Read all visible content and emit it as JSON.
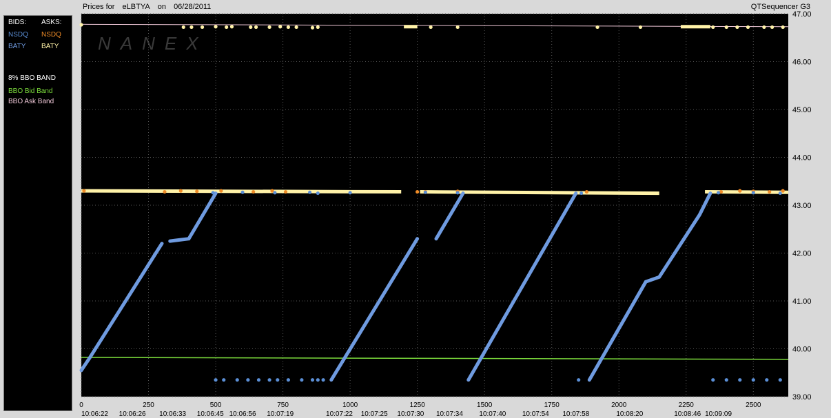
{
  "window": {
    "prices_for": "Prices for",
    "symbol": "eLBTYA",
    "on": "on",
    "date": "06/28/2011",
    "app": "QTSequencer G3",
    "watermark": "NANEX"
  },
  "legend": {
    "bids_label": "BIDS:",
    "asks_label": "ASKS:",
    "bid_nsdq": "NSDQ",
    "ask_nsdq": "NSDQ",
    "bid_baty": "BATY",
    "ask_baty": "BATY",
    "band_title": "8% BBO BAND",
    "bid_band": "BBO Bid Band",
    "ask_band": "BBO Ask Band",
    "colors": {
      "nsdq_bid": "#5b8fd6",
      "nsdq_ask": "#f08c28",
      "baty_bid": "#6f9be0",
      "baty_ask": "#fff2a8",
      "bid_band": "#7cdc3c",
      "ask_band": "#f0c8d8"
    }
  },
  "chart_data": {
    "type": "scatter",
    "ylim": [
      39.0,
      47.0
    ],
    "xlim": [
      0,
      2630
    ],
    "y_ticks": [
      "39.00",
      "40.00",
      "41.00",
      "42.00",
      "43.00",
      "44.00",
      "45.00",
      "46.00",
      "47.00"
    ],
    "x_ticks": [
      "0",
      "250",
      "500",
      "750",
      "1000",
      "1250",
      "1500",
      "1750",
      "2000",
      "2250",
      "2500"
    ],
    "x_times": [
      {
        "x": 50,
        "t": "10:06:22"
      },
      {
        "x": 190,
        "t": "10:06:26"
      },
      {
        "x": 340,
        "t": "10:06:33"
      },
      {
        "x": 480,
        "t": "10:06:45"
      },
      {
        "x": 600,
        "t": "10:06:56"
      },
      {
        "x": 740,
        "t": "10:07:19"
      },
      {
        "x": 960,
        "t": "10:07:22"
      },
      {
        "x": 1090,
        "t": "10:07:25"
      },
      {
        "x": 1225,
        "t": "10:07:30"
      },
      {
        "x": 1370,
        "t": "10:07:34"
      },
      {
        "x": 1530,
        "t": "10:07:40"
      },
      {
        "x": 1690,
        "t": "10:07:54"
      },
      {
        "x": 1840,
        "t": "10:07:58"
      },
      {
        "x": 2040,
        "t": "10:08:20"
      },
      {
        "x": 2255,
        "t": "10:08:46"
      },
      {
        "x": 2370,
        "t": "10:09:09"
      }
    ],
    "series": [
      {
        "name": "BATY",
        "segments": [
          [
            [
              0,
              39.55
            ],
            [
              30,
              39.8
            ],
            [
              300,
              42.2
            ]
          ],
          [
            [
              330,
              42.25
            ],
            [
              400,
              42.3
            ],
            [
              500,
              43.25
            ]
          ],
          [
            [
              930,
              39.35
            ],
            [
              1250,
              42.3
            ]
          ],
          [
            [
              1320,
              42.3
            ],
            [
              1420,
              43.25
            ]
          ],
          [
            [
              1440,
              39.35
            ],
            [
              1840,
              43.25
            ]
          ],
          [
            [
              1890,
              39.35
            ],
            [
              2100,
              41.4
            ],
            [
              2150,
              41.5
            ],
            [
              2300,
              42.8
            ],
            [
              2340,
              43.25
            ]
          ]
        ]
      },
      {
        "name": "NSDQ",
        "points": [
          [
            490,
            43.26
          ],
          [
            600,
            43.27
          ],
          [
            720,
            43.26
          ],
          [
            850,
            43.27
          ],
          [
            880,
            43.25
          ],
          [
            1000,
            43.26
          ],
          [
            1280,
            43.27
          ],
          [
            1400,
            43.26
          ],
          [
            1860,
            43.25
          ],
          [
            2370,
            43.26
          ],
          [
            2500,
            43.26
          ],
          [
            2600,
            43.25
          ]
        ],
        "low_points": [
          [
            500,
            39.35
          ],
          [
            530,
            39.35
          ],
          [
            580,
            39.35
          ],
          [
            620,
            39.35
          ],
          [
            660,
            39.35
          ],
          [
            700,
            39.35
          ],
          [
            730,
            39.35
          ],
          [
            770,
            39.35
          ],
          [
            820,
            39.35
          ],
          [
            860,
            39.35
          ],
          [
            880,
            39.35
          ],
          [
            900,
            39.35
          ],
          [
            1850,
            39.35
          ],
          [
            2350,
            39.35
          ],
          [
            2400,
            39.35
          ],
          [
            2450,
            39.35
          ],
          [
            2500,
            39.35
          ],
          [
            2550,
            39.35
          ],
          [
            2600,
            39.35
          ]
        ]
      },
      {
        "name": "NSDQ",
        "points": [
          [
            10,
            43.3
          ],
          [
            310,
            43.28
          ],
          [
            370,
            43.3
          ],
          [
            430,
            43.29
          ],
          [
            520,
            43.3
          ],
          [
            640,
            43.28
          ],
          [
            710,
            43.3
          ],
          [
            760,
            43.28
          ],
          [
            1250,
            43.28
          ],
          [
            1280,
            43.28
          ],
          [
            1400,
            43.29
          ],
          [
            1880,
            43.28
          ],
          [
            2380,
            43.28
          ],
          [
            2450,
            43.3
          ],
          [
            2500,
            43.29
          ],
          [
            2560,
            43.28
          ],
          [
            2610,
            43.3
          ]
        ]
      },
      {
        "name": "BATY",
        "main": [
          [
            0,
            43.3
          ],
          [
            1190,
            43.28
          ]
        ],
        "main2": [
          [
            1260,
            43.28
          ],
          [
            2150,
            43.25
          ]
        ],
        "main3": [
          [
            2320,
            43.28
          ],
          [
            2630,
            43.27
          ]
        ],
        "upper": [
          [
            0,
            46.77
          ],
          [
            380,
            46.72
          ],
          [
            410,
            46.72
          ],
          [
            450,
            46.72
          ],
          [
            500,
            46.73
          ],
          [
            540,
            46.72
          ],
          [
            560,
            46.73
          ],
          [
            630,
            46.72
          ],
          [
            650,
            46.72
          ],
          [
            700,
            46.72
          ],
          [
            740,
            46.73
          ],
          [
            770,
            46.72
          ],
          [
            800,
            46.72
          ],
          [
            860,
            46.71
          ],
          [
            880,
            46.72
          ],
          [
            1300,
            46.72
          ],
          [
            1400,
            46.72
          ],
          [
            1920,
            46.72
          ],
          [
            2080,
            46.72
          ],
          [
            2350,
            46.72
          ],
          [
            2400,
            46.72
          ],
          [
            2440,
            46.72
          ],
          [
            2480,
            46.72
          ],
          [
            2540,
            46.72
          ],
          [
            2570,
            46.72
          ],
          [
            2610,
            46.72
          ]
        ],
        "upper_dense": [
          [
            1200,
            1250,
            46.73
          ],
          [
            2230,
            2340,
            46.73
          ]
        ]
      },
      {
        "name": "BBO Bid Band",
        "points": [
          [
            0,
            39.82
          ],
          [
            2630,
            39.78
          ]
        ]
      },
      {
        "name": "BBO Ask Band",
        "points": [
          [
            0,
            46.78
          ],
          [
            2630,
            46.73
          ]
        ]
      }
    ]
  }
}
